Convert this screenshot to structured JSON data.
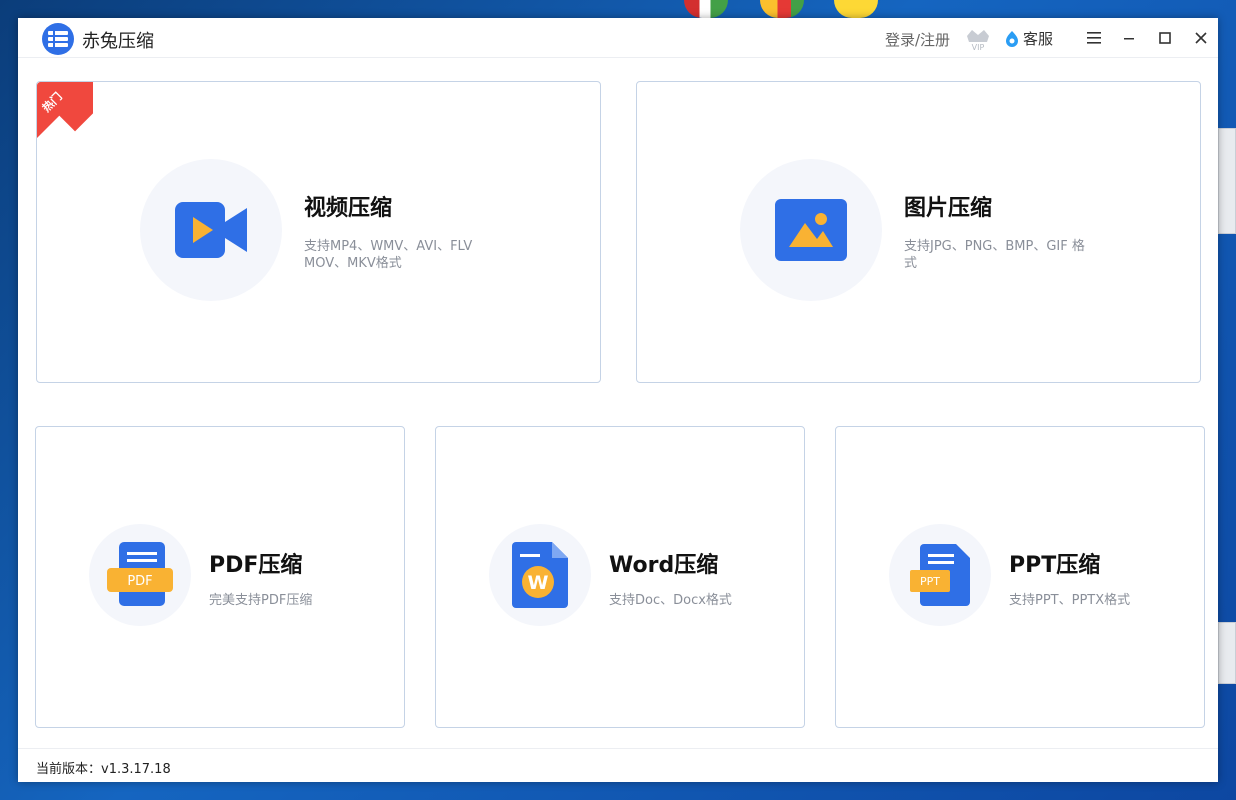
{
  "window": {
    "title": "赤兔压缩",
    "header": {
      "login_label": "登录/注册",
      "vip_label": "VIP",
      "service_label": "客服"
    }
  },
  "cards": {
    "video": {
      "title": "视频压缩",
      "desc": "支持MP4、WMV、AVI、FLV MOV、MKV格式",
      "badge": "热门"
    },
    "image": {
      "title": "图片压缩",
      "desc": "支持JPG、PNG、BMP、GIF 格式"
    },
    "pdf": {
      "title": "PDF压缩",
      "desc": "完美支持PDF压缩",
      "icon_text": "PDF"
    },
    "word": {
      "title": "Word压缩",
      "desc": "支持Doc、Docx格式",
      "icon_text": "W"
    },
    "ppt": {
      "title": "PPT压缩",
      "desc": "支持PPT、PPTX格式",
      "icon_text": "PPT"
    }
  },
  "footer": {
    "version": "当前版本：v1.3.17.18"
  },
  "colors": {
    "accent": "#2f6fe6",
    "orange": "#f9b233",
    "hot": "#f0483e"
  }
}
